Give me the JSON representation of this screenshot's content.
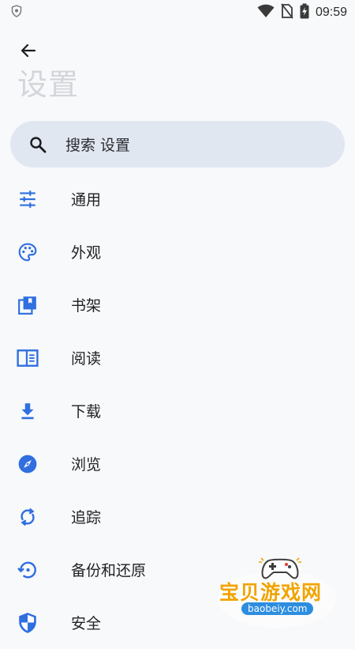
{
  "status_bar": {
    "time": "09:59"
  },
  "header": {
    "title": "设置"
  },
  "search": {
    "placeholder": "搜索 设置"
  },
  "menu": {
    "items": [
      {
        "label": "通用",
        "icon": "tune-icon"
      },
      {
        "label": "外观",
        "icon": "palette-icon"
      },
      {
        "label": "书架",
        "icon": "library-icon"
      },
      {
        "label": "阅读",
        "icon": "chrome-reader-icon"
      },
      {
        "label": "下载",
        "icon": "download-icon"
      },
      {
        "label": "浏览",
        "icon": "compass-icon"
      },
      {
        "label": "追踪",
        "icon": "sync-icon"
      },
      {
        "label": "备份和还原",
        "icon": "backup-restore-icon"
      },
      {
        "label": "安全",
        "icon": "shield-icon"
      }
    ]
  },
  "watermark": {
    "text": "宝贝游戏网",
    "url": "baobeiy.com"
  },
  "colors": {
    "accent": "#2f6fe0",
    "background": "#f8f9fb",
    "search_bg": "#e1e7f1",
    "title_color": "#d3d5da",
    "watermark_orange": "#f0a400"
  }
}
